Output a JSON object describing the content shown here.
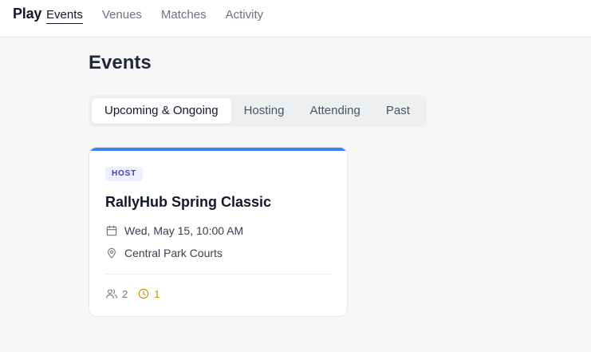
{
  "app": {
    "brand": "Play"
  },
  "nav": {
    "items": [
      {
        "label": "Events",
        "active": true
      },
      {
        "label": "Venues",
        "active": false
      },
      {
        "label": "Matches",
        "active": false
      },
      {
        "label": "Activity",
        "active": false
      }
    ]
  },
  "page": {
    "title": "Events"
  },
  "tabs": [
    {
      "label": "Upcoming & Ongoing",
      "active": true
    },
    {
      "label": "Hosting",
      "active": false
    },
    {
      "label": "Attending",
      "active": false
    },
    {
      "label": "Past",
      "active": false
    }
  ],
  "events": [
    {
      "role_badge": "HOST",
      "title": "RallyHub Spring Classic",
      "datetime": "Wed, May 15, 10:00 AM",
      "location": "Central Park Courts",
      "participants_count": "2",
      "pending_count": "1",
      "icons": {
        "date": "calendar-icon",
        "location": "map-pin-icon",
        "participants": "users-icon",
        "pending": "clock-icon"
      }
    }
  ],
  "colors": {
    "accent": "#3b82f6",
    "badge_bg": "#eef0ff",
    "badge_text": "#4338ca",
    "pending": "#ca8a04",
    "muted": "#6b7280"
  }
}
